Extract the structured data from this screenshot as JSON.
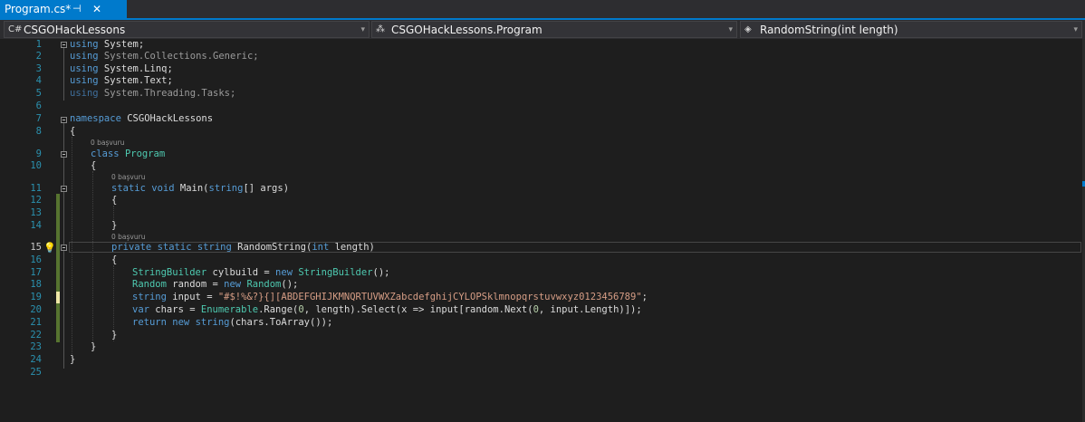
{
  "tab": {
    "title": "Program.cs*",
    "pin_glyph": "⊣",
    "close_glyph": "✕"
  },
  "navbar": {
    "project": {
      "icon": "C#",
      "label": "CSGOHackLessons"
    },
    "type": {
      "icon": "⁂",
      "label": "CSGOHackLessons.Program"
    },
    "member": {
      "icon": "◈",
      "label": "RandomString(int length)"
    },
    "dropdown_glyph": "▾"
  },
  "editor": {
    "line_numbers": [
      "1",
      "2",
      "3",
      "4",
      "5",
      "6",
      "7",
      "8",
      "9",
      "10",
      "11",
      "12",
      "13",
      "14",
      "15",
      "16",
      "17",
      "18",
      "19",
      "20",
      "21",
      "22",
      "23",
      "24",
      "25"
    ],
    "codelens": [
      "0 başvuru",
      "0 başvuru",
      "0 başvuru"
    ],
    "lightbulb_glyph": "💡",
    "code": {
      "l1": [
        "using",
        " System;"
      ],
      "l2": [
        "using",
        " System.Collections.Generic;"
      ],
      "l3": [
        "using",
        " System.Linq;"
      ],
      "l4": [
        "using",
        " System.Text;"
      ],
      "l5": [
        "using",
        " System.Threading.Tasks;"
      ],
      "l7": [
        "namespace",
        " CSGOHackLessons"
      ],
      "l8": "{",
      "l9": [
        "class",
        " ",
        "Program"
      ],
      "l10": "{",
      "l11": [
        "static",
        " ",
        "void",
        " Main(",
        "string",
        "[] args)"
      ],
      "l12": "{",
      "l14": "}",
      "l15": [
        "private",
        " ",
        "static",
        " ",
        "string",
        " RandomString(",
        "int",
        " length)"
      ],
      "l16": "{",
      "l17": [
        "StringBuilder",
        " cylbuild = ",
        "new",
        " ",
        "StringBuilder",
        "();"
      ],
      "l18": [
        "Random",
        " random = ",
        "new",
        " ",
        "Random",
        "();"
      ],
      "l19": [
        "string",
        " input = ",
        "\"#$!%&?}{][ABDEFGHIJKMNQRTUVWXZabcdefghijCYLOPSklmnopqrstuvwxyz0123456789\"",
        ";"
      ],
      "l20": [
        "var",
        " chars = ",
        "Enumerable",
        ".Range(",
        "0",
        ", length).Select(x => input[random.Next(",
        "0",
        ", input.Length)]);"
      ],
      "l21": [
        "return",
        " ",
        "new",
        " ",
        "string",
        "(chars.ToArray());"
      ],
      "l22": "}",
      "l23": "}",
      "l24": "}"
    }
  },
  "colors": {
    "accent": "#007acc",
    "keyword": "#569cd6",
    "type": "#4ec9b0",
    "string": "#d69d85",
    "number": "#b5cea8",
    "line_number": "#2b91af",
    "change_saved": "#577430",
    "change_unsaved": "#efe7a6"
  }
}
